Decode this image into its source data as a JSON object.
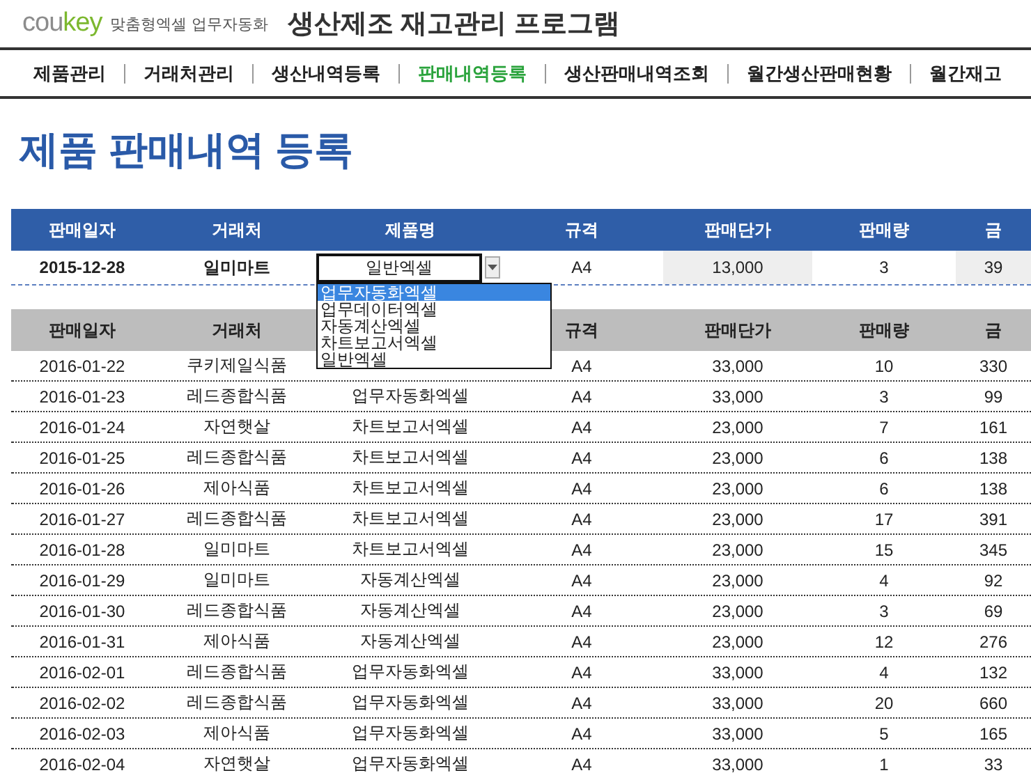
{
  "brand": {
    "logo": [
      "cou",
      "key"
    ],
    "tagline": "맞춤형엑셀 업무자동화",
    "title": "생산제조 재고관리 프로그램"
  },
  "nav": [
    {
      "label": "제품관리",
      "selected": false
    },
    {
      "label": "거래처관리",
      "selected": false
    },
    {
      "label": "생산내역등록",
      "selected": false
    },
    {
      "label": "판매내역등록",
      "selected": true
    },
    {
      "label": "생산판매내역조회",
      "selected": false
    },
    {
      "label": "월간생산판매현황",
      "selected": false
    },
    {
      "label": "월간재고",
      "selected": false
    }
  ],
  "page_title": "제품 판매내역 등록",
  "entry": {
    "columns": [
      "판매일자",
      "거래처",
      "제품명",
      "규격",
      "판매단가",
      "판매량",
      "금"
    ],
    "row": {
      "date": "2015-12-28",
      "client": "일미마트",
      "product": "일반엑셀",
      "spec": "A4",
      "price": "13,000",
      "qty": "3",
      "amount": "39"
    },
    "dropdown": [
      {
        "label": "업무자동화엑셀",
        "selected": true
      },
      {
        "label": "업무데이터엑셀",
        "selected": false
      },
      {
        "label": "자동계산엑셀",
        "selected": false
      },
      {
        "label": "차트보고서엑셀",
        "selected": false
      },
      {
        "label": "일반엑셀",
        "selected": false
      }
    ]
  },
  "table": {
    "columns": [
      "판매일자",
      "거래처",
      null,
      "규격",
      "판매단가",
      "판매량",
      "금"
    ],
    "rows": [
      [
        "2016-01-22",
        "쿠키제일식품",
        null,
        "A4",
        "33,000",
        "10",
        "330"
      ],
      [
        "2016-01-23",
        "레드종합식품",
        "업무자동화엑셀",
        "A4",
        "33,000",
        "3",
        "99"
      ],
      [
        "2016-01-24",
        "자연햇살",
        "차트보고서엑셀",
        "A4",
        "23,000",
        "7",
        "161"
      ],
      [
        "2016-01-25",
        "레드종합식품",
        "차트보고서엑셀",
        "A4",
        "23,000",
        "6",
        "138"
      ],
      [
        "2016-01-26",
        "제아식품",
        "차트보고서엑셀",
        "A4",
        "23,000",
        "6",
        "138"
      ],
      [
        "2016-01-27",
        "레드종합식품",
        "차트보고서엑셀",
        "A4",
        "23,000",
        "17",
        "391"
      ],
      [
        "2016-01-28",
        "일미마트",
        "차트보고서엑셀",
        "A4",
        "23,000",
        "15",
        "345"
      ],
      [
        "2016-01-29",
        "일미마트",
        "자동계산엑셀",
        "A4",
        "23,000",
        "4",
        "92"
      ],
      [
        "2016-01-30",
        "레드종합식품",
        "자동계산엑셀",
        "A4",
        "23,000",
        "3",
        "69"
      ],
      [
        "2016-01-31",
        "제아식품",
        "자동계산엑셀",
        "A4",
        "23,000",
        "12",
        "276"
      ],
      [
        "2016-02-01",
        "레드종합식품",
        "업무자동화엑셀",
        "A4",
        "33,000",
        "4",
        "132"
      ],
      [
        "2016-02-02",
        "레드종합식품",
        "업무자동화엑셀",
        "A4",
        "33,000",
        "20",
        "660"
      ],
      [
        "2016-02-03",
        "제아식품",
        "업무자동화엑셀",
        "A4",
        "33,000",
        "5",
        "165"
      ],
      [
        "2016-02-04",
        "자연햇살",
        "업무자동화엑셀",
        "A4",
        "33,000",
        "1",
        "33"
      ]
    ]
  }
}
